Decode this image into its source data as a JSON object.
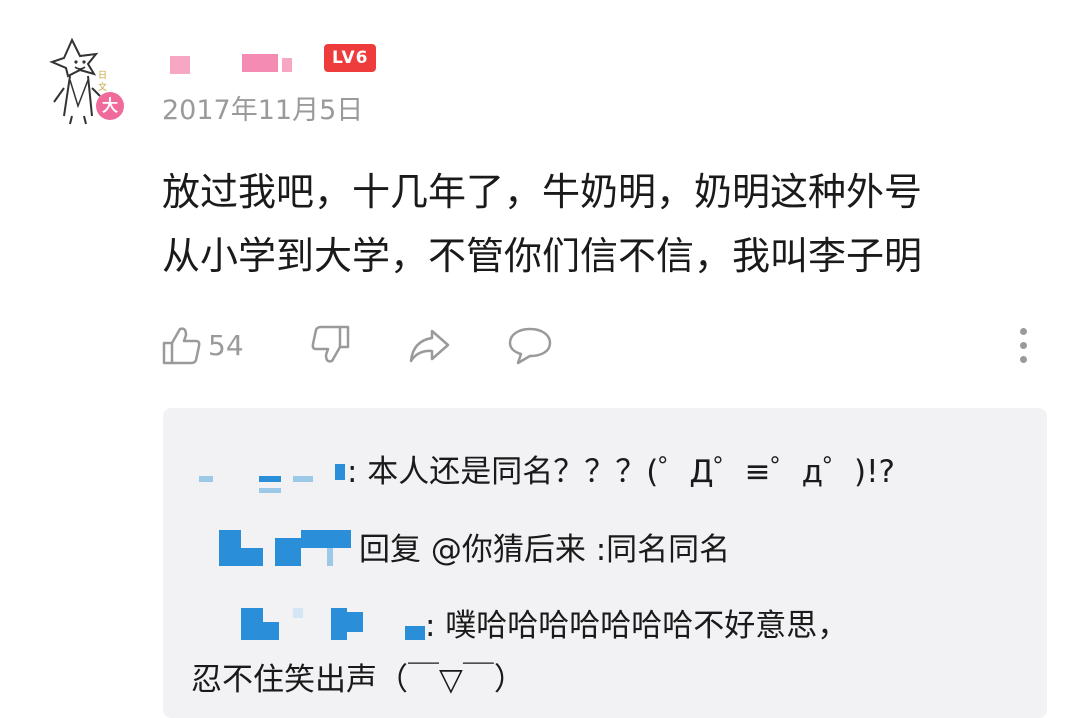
{
  "post": {
    "user": {
      "name": "",
      "level_badge": "LV6"
    },
    "avatar": {
      "badge_char": "大"
    },
    "date": "2017年11月5日",
    "comment_lines": [
      "放过我吧，十几年了，牛奶明，奶明这种外号",
      "从小学到大学，不管你们信不信，我叫李子明"
    ],
    "actions": {
      "like_count": "54"
    }
  },
  "replies": [
    {
      "text": ": 本人还是同名？？？(゜Д゜≡゜д゜)!?"
    },
    {
      "text": "回复 @你猜后来 :同名同名"
    },
    {
      "text_line1": ": 噗哈哈哈哈哈哈哈不好意思，",
      "text_line2": "忍不住笑出声（￣▽￣）"
    }
  ],
  "colors": {
    "accent_red": "#ee3b3b",
    "pink": "#f06a9c",
    "blue": "#2a8fd8",
    "gray_text": "#9a9a9a",
    "reply_bg": "#f2f2f4"
  }
}
